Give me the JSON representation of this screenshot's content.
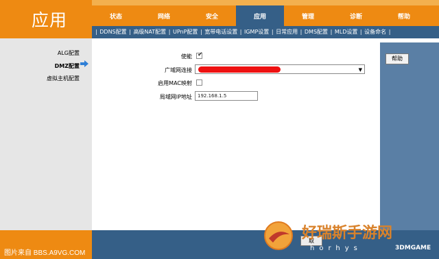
{
  "brand": {
    "title": "应用"
  },
  "nav": {
    "tabs": [
      {
        "label": "状态"
      },
      {
        "label": "网络"
      },
      {
        "label": "安全"
      },
      {
        "label": "应用"
      },
      {
        "label": "管理"
      },
      {
        "label": "诊断"
      },
      {
        "label": "帮助"
      }
    ],
    "active_tab": "应用"
  },
  "submenu": {
    "items": [
      {
        "label": "DDNS配置"
      },
      {
        "label": "高级NAT配置"
      },
      {
        "label": "UPnP配置"
      },
      {
        "label": "宽带电话设置"
      },
      {
        "label": "IGMP设置"
      },
      {
        "label": "日常应用"
      },
      {
        "label": "DMS配置"
      },
      {
        "label": "MLD设置"
      },
      {
        "label": "设备命名"
      }
    ],
    "active": "高级NAT配置"
  },
  "sidebar": {
    "items": [
      {
        "label": "ALG配置"
      },
      {
        "label": "DMZ配置"
      },
      {
        "label": "虚拟主机配置"
      }
    ],
    "active": "DMZ配置"
  },
  "form": {
    "enable_label": "使能",
    "enable_checked": true,
    "wan_label": "广域网连接",
    "mac_label": "启用MAC映射",
    "mac_checked": false,
    "lan_ip_label": "局域网IP地址",
    "lan_ip_value": "192.168.1.5"
  },
  "help_button": "帮助",
  "footer_button": "取",
  "credit": "图片来自 BBS.A9VG.COM",
  "watermark": {
    "main": "好瑞斯手游网",
    "sub": "horhys",
    "brand": "3DMGAME"
  },
  "colors": {
    "orange": "#ee8a12",
    "blue": "#355f87",
    "sidebar_gray": "#e6e6e6"
  }
}
